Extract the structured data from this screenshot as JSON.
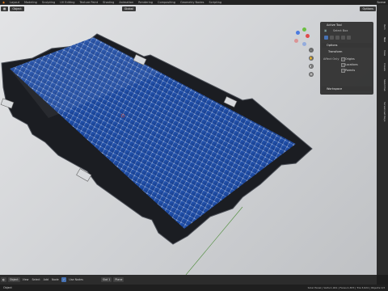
{
  "menu": {
    "workspaces": [
      "Layout",
      "Modeling",
      "Sculpting",
      "UV Editing",
      "Texture Paint",
      "Shading",
      "Animation",
      "Rendering",
      "Compositing",
      "Geometry Nodes",
      "Scripting"
    ],
    "active_workspace": "Layout",
    "scene_label": "Scene"
  },
  "viewport_header": {
    "mode": "Object",
    "orientation": "Global",
    "options": "Options"
  },
  "npanel": {
    "active_tool": "Active Tool",
    "select_box": "Select Box",
    "options": "Options",
    "transform": "Transform",
    "affect_only": "Affect Only",
    "origins": "Origins",
    "locations": "Locations",
    "parents": "Parents",
    "workspace": "Workspace"
  },
  "sidebar_tabs": [
    "Item",
    "Tool",
    "View",
    "Create",
    "Sketchfab",
    "Screencast Keys"
  ],
  "timeline": {
    "playback": "Playback",
    "mode": "Object",
    "view": "View",
    "select": "Select",
    "add": "Add",
    "node": "Node",
    "use_nodes": "Use Nodes",
    "slot": "Slot 1",
    "material": "Plane"
  },
  "statusbar": {
    "object_label": "Object",
    "info": "Solar Panel | Verts:1,941 | Faces:1,833 | Tris:3,624 | Objects:1/3"
  },
  "colors": {
    "panel_cell": "#1f4a9a",
    "panel_frame": "#1b1d22",
    "viewport_bg": "#d4d6d9",
    "accent": "#4772b3"
  }
}
